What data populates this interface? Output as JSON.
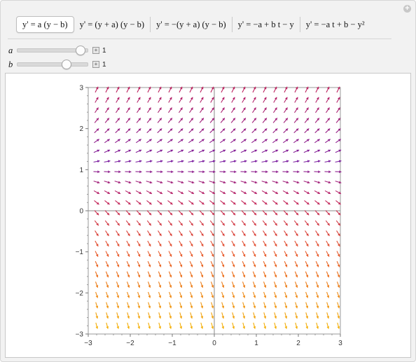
{
  "tabs": [
    {
      "label": "y' = a (y − b)",
      "active": true
    },
    {
      "label": "y' = (y + a) (y − b)",
      "active": false
    },
    {
      "label": "y' = −(y + a) (y − b)",
      "active": false
    },
    {
      "label": "y' = −a + b t − y",
      "active": false
    },
    {
      "label": "y' = −a t + b − y²",
      "active": false
    }
  ],
  "controls": [
    {
      "name": "a",
      "value": "1",
      "fraction": 0.9
    },
    {
      "name": "b",
      "value": "1",
      "fraction": 0.7
    }
  ],
  "colors": {
    "panel_bg": "#f2f2f2",
    "field_low": "#f5b800",
    "field_mid": "#e8572a",
    "field_high": "#c0235e",
    "field_top": "#7c1fa0"
  },
  "chart_data": {
    "type": "vector-field",
    "equation": "y' = a (y − b)",
    "a": 1,
    "b": 1,
    "xlim": [
      -3,
      3
    ],
    "ylim": [
      -3,
      3
    ],
    "xticks": [
      -3,
      -2,
      -1,
      0,
      1,
      2,
      3
    ],
    "yticks": [
      -3,
      -2,
      -1,
      0,
      1,
      2,
      3
    ],
    "grid_x": [
      -2.8,
      -2.55,
      -2.3,
      -2.05,
      -1.8,
      -1.55,
      -1.3,
      -1.05,
      -0.8,
      -0.55,
      -0.3,
      -0.05,
      0.2,
      0.45,
      0.7,
      0.95,
      1.2,
      1.45,
      1.7,
      1.95,
      2.2,
      2.45,
      2.7,
      2.95
    ],
    "grid_y": [
      -2.8,
      -2.55,
      -2.3,
      -2.05,
      -1.8,
      -1.55,
      -1.3,
      -1.05,
      -0.8,
      -0.55,
      -0.3,
      -0.05,
      0.2,
      0.45,
      0.7,
      0.95,
      1.2,
      1.45,
      1.7,
      1.95,
      2.2,
      2.45,
      2.7,
      2.95
    ]
  }
}
